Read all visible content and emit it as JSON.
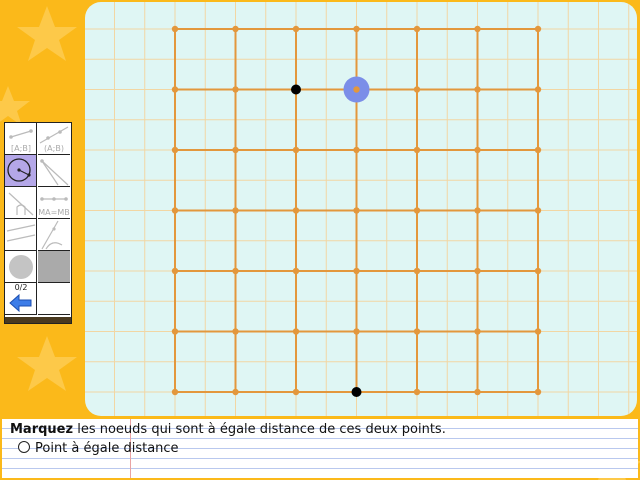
{
  "canvas": {
    "grid_lines": {
      "cols": 6,
      "rows": 6
    },
    "colors": {
      "grid": "#e3973c",
      "background_grid": "#f2d6a3",
      "point": "#000000",
      "cursor": "#7b8ee8"
    }
  },
  "toolbar": {
    "tools": [
      {
        "name": "segment-tool",
        "label": "[A;B]"
      },
      {
        "name": "line-tool",
        "label": "(A;B)"
      },
      {
        "name": "circle-tool",
        "label": ""
      },
      {
        "name": "ray-tool",
        "label": ""
      },
      {
        "name": "arc-tool",
        "label": ""
      },
      {
        "name": "midpoint-tool",
        "label": "MA=MB"
      },
      {
        "name": "pencil-tool",
        "label": ""
      },
      {
        "name": "angle-tool",
        "label": ""
      },
      {
        "name": "point-tool",
        "label": ""
      },
      {
        "name": "fill-tool",
        "label": ""
      }
    ],
    "counter": "0/2"
  },
  "prompt": {
    "instruction_bold": "Marquez",
    "instruction_rest": " les noeuds qui sont à égale distance de ces deux points.",
    "option_label": "Point à égale distance"
  }
}
